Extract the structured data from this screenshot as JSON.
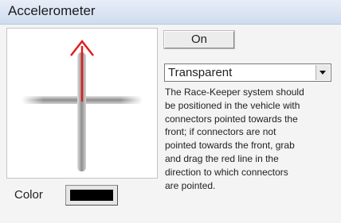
{
  "window": {
    "title": "Accelerometer"
  },
  "toggle": {
    "label": "On"
  },
  "dropdown": {
    "value": "Transparent"
  },
  "color": {
    "label": "Color",
    "value": "#000000"
  },
  "description": {
    "lines": [
      "The Race-Keeper system should",
      "be positioned in the vehicle with",
      "connectors pointed towards the",
      "front; if connectors are not",
      "pointed towards the front, grab",
      "and drag the red line in the",
      "direction to which connectors",
      "are pointed."
    ]
  },
  "preview": {
    "arrow_color": "#e01e1e",
    "axis_color": "#9a9a9a",
    "icons": [
      "crosshair-icon",
      "direction-arrow-icon"
    ]
  }
}
